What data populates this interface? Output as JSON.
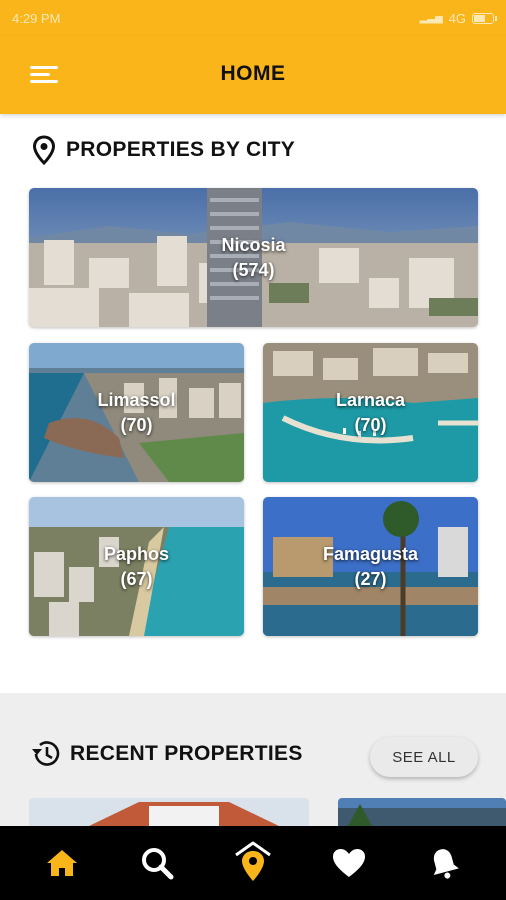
{
  "status_bar": {
    "time": "4:29 PM",
    "network": "4G"
  },
  "app_bar": {
    "title": "HOME"
  },
  "properties_by_city": {
    "title": "PROPERTIES BY CITY",
    "cities": [
      {
        "name": "Nicosia",
        "count": "(574)"
      },
      {
        "name": "Limassol",
        "count": "(70)"
      },
      {
        "name": "Larnaca",
        "count": "(70)"
      },
      {
        "name": "Paphos",
        "count": "(67)"
      },
      {
        "name": "Famagusta",
        "count": "(27)"
      }
    ]
  },
  "recent_properties": {
    "title": "RECENT PROPERTIES",
    "see_all_label": "SEE ALL"
  },
  "bottom_nav": {
    "items": [
      {
        "icon": "home-icon",
        "active": true
      },
      {
        "icon": "search-icon",
        "active": false
      },
      {
        "icon": "home-location-icon",
        "active": false
      },
      {
        "icon": "heart-icon",
        "active": false
      },
      {
        "icon": "bell-icon",
        "active": false
      }
    ]
  },
  "colors": {
    "primary": "#f9b51a",
    "nav_bg": "#000000",
    "active_icon": "#f9b51a",
    "inactive_icon": "#ffffff"
  }
}
